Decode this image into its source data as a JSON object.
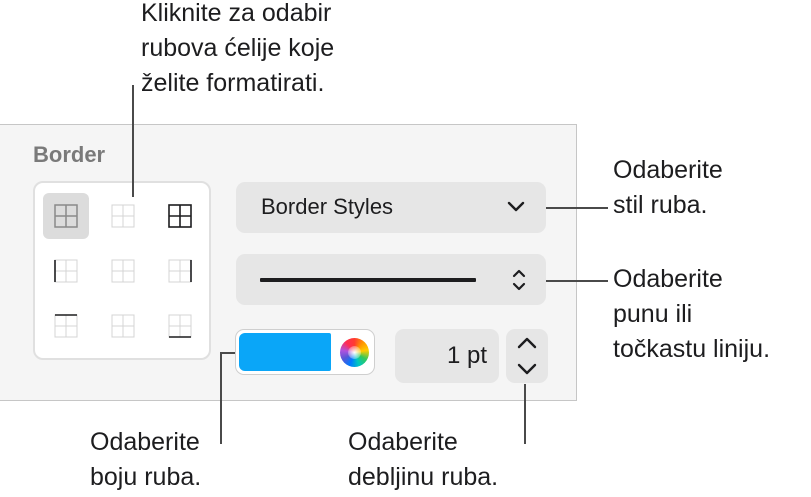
{
  "panel": {
    "section_title": "Border",
    "border_styles_label": "Border Styles",
    "border_width": "1 pt",
    "border_color": "#0aa6f8",
    "border_options": [
      {
        "name": "all-borders",
        "selected": true
      },
      {
        "name": "inside-borders",
        "selected": false
      },
      {
        "name": "outside-borders",
        "selected": false
      },
      {
        "name": "left-border",
        "selected": false
      },
      {
        "name": "inside-vertical",
        "selected": false
      },
      {
        "name": "right-border",
        "selected": false
      },
      {
        "name": "top-border",
        "selected": false
      },
      {
        "name": "inside-horizontal",
        "selected": false
      },
      {
        "name": "bottom-border",
        "selected": false
      }
    ]
  },
  "callouts": {
    "cell_borders": "Kliknite za odabir\nrubova ćelije koje\nželite formatirati.",
    "border_style": "Odaberite\nstil ruba.",
    "line_type": "Odaberite\npunu ili\ntočkastu liniju.",
    "border_color": "Odaberite\nboju ruba.",
    "border_width": "Odaberite\ndebljinu ruba."
  },
  "icons": {
    "dropdown": "chevron-down-icon",
    "line_popup": "up-down-chevron-icon",
    "stepper_up": "chevron-up-icon",
    "stepper_down": "chevron-down-icon",
    "color_picker": "color-wheel-icon"
  }
}
